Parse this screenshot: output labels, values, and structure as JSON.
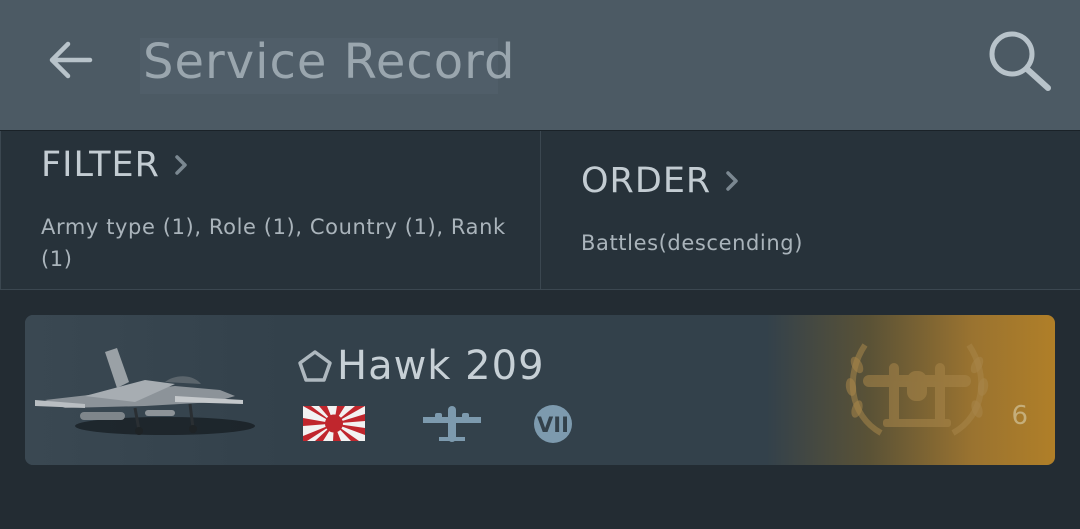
{
  "header": {
    "title": "Service Record",
    "back_icon": "arrow-left-icon",
    "search_icon": "magnifier-icon"
  },
  "filter": {
    "label": "FILTER",
    "summary": "Army type (1), Role (1), Country (1), Rank (1)"
  },
  "order": {
    "label": "ORDER",
    "summary": "Battles(descending)"
  },
  "vehicles": [
    {
      "name": "Hawk 209",
      "country_icon": "rising-sun-flag-icon",
      "role_icon": "bomber-aircraft-icon",
      "rank": "VII",
      "count": "6",
      "achievement_icon": "laurel-aircraft-emblem-icon"
    }
  ],
  "colors": {
    "header_bg": "#4c5a64",
    "panel_bg": "#27323a",
    "page_bg": "#232c33",
    "card_bg": "#33414b",
    "accent_gold": "#b07f28"
  }
}
